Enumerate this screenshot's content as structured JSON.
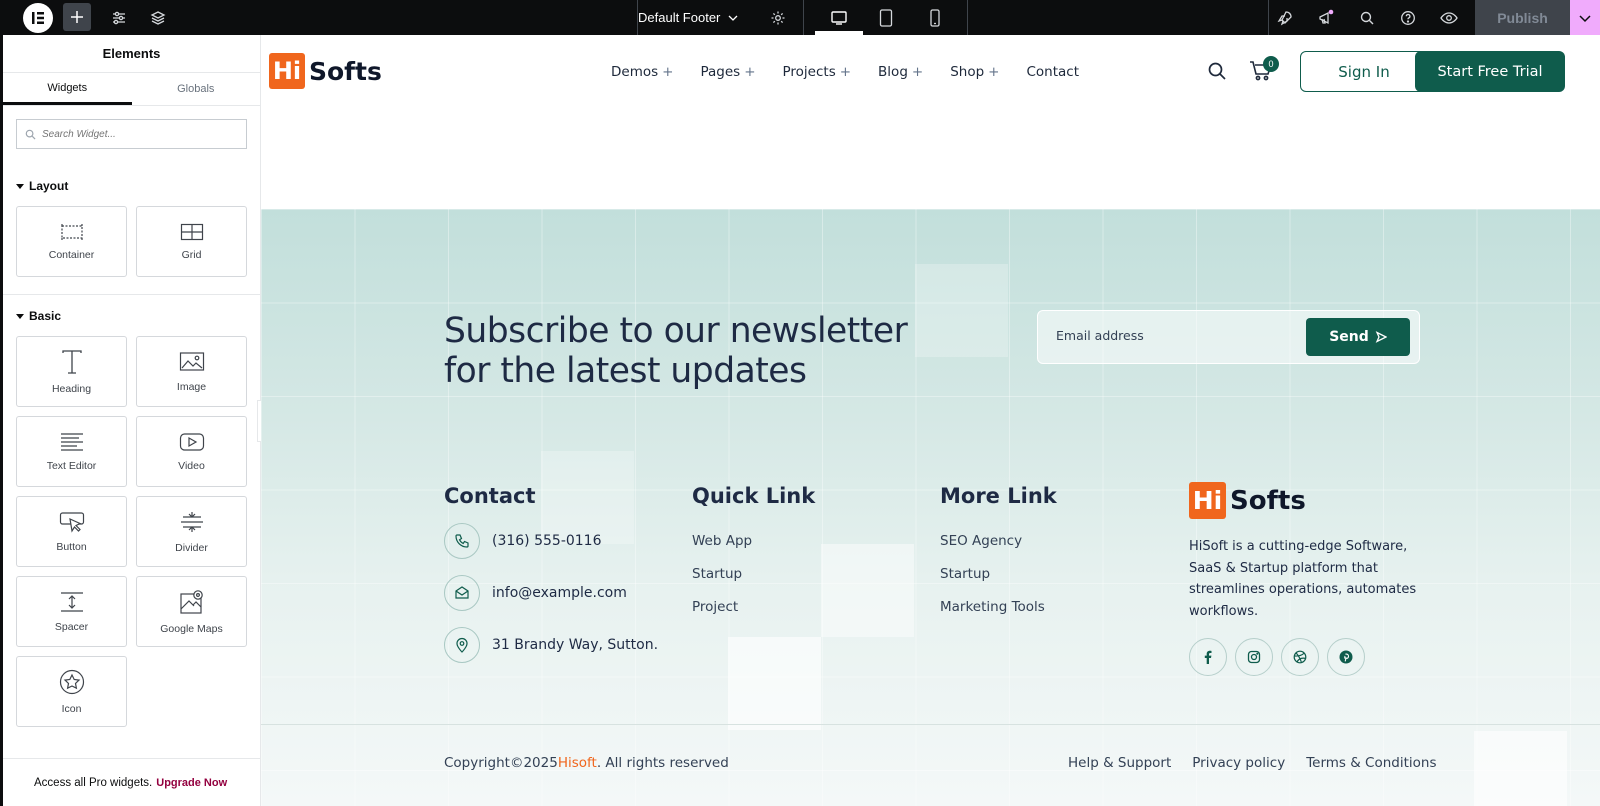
{
  "topbar": {
    "template_name": "Default Footer",
    "publish_label": "Publish",
    "colors": {
      "bar": "#0c0d0e",
      "accent": "#f0abfc"
    }
  },
  "panel": {
    "title": "Elements",
    "tabs": [
      "Widgets",
      "Globals"
    ],
    "search_placeholder": "Search Widget...",
    "categories": [
      {
        "name": "Layout",
        "widgets": [
          {
            "label": "Container",
            "icon": "container-icon"
          },
          {
            "label": "Grid",
            "icon": "grid-icon"
          }
        ]
      },
      {
        "name": "Basic",
        "widgets": [
          {
            "label": "Heading",
            "icon": "heading-icon"
          },
          {
            "label": "Image",
            "icon": "image-icon"
          },
          {
            "label": "Text Editor",
            "icon": "text-editor-icon"
          },
          {
            "label": "Video",
            "icon": "video-icon"
          },
          {
            "label": "Button",
            "icon": "button-icon"
          },
          {
            "label": "Divider",
            "icon": "divider-icon"
          },
          {
            "label": "Spacer",
            "icon": "spacer-icon"
          },
          {
            "label": "Google Maps",
            "icon": "google-maps-icon"
          },
          {
            "label": "Icon",
            "icon": "star-icon"
          }
        ]
      }
    ],
    "promo_text": "Access all Pro widgets.",
    "promo_link": "Upgrade Now"
  },
  "site": {
    "brand": {
      "hi": "Hi",
      "name": "Softs"
    },
    "nav": [
      {
        "label": "Demos",
        "plus": "+"
      },
      {
        "label": "Pages",
        "plus": "+"
      },
      {
        "label": "Projects",
        "plus": "+"
      },
      {
        "label": "Blog",
        "plus": "+"
      },
      {
        "label": "Shop",
        "plus": "+"
      },
      {
        "label": "Contact",
        "plus": ""
      }
    ],
    "cart_count": "0",
    "sign_in": "Sign In",
    "trial": "Start Free Trial",
    "brand_color": "#0f5c4c",
    "accent_color": "#f0661d"
  },
  "footer": {
    "newsletter_line1": "Subscribe to our newsletter",
    "newsletter_line2": "for the latest updates",
    "email_placeholder": "Email address",
    "send": "Send",
    "contact": {
      "title": "Contact",
      "phone": "(316) 555-0116",
      "email": "info@example.com",
      "address": "31 Brandy Way, Sutton."
    },
    "quick": {
      "title": "Quick Link",
      "links": [
        "Web App",
        "Startup",
        "Project"
      ]
    },
    "more": {
      "title": "More Link",
      "links": [
        "SEO Agency",
        "Startup",
        "Marketing Tools"
      ]
    },
    "about": "HiSoft is a cutting-edge Software, SaaS & Startup platform that streamlines operations, automates workflows.",
    "social": [
      "facebook-icon",
      "instagram-icon",
      "dribbble-icon",
      "pinterest-icon"
    ],
    "copyright_pre": "Copyright©2025",
    "copyright_brand": "Hisoft",
    "copyright_post": ". All rights reserved",
    "bottom_links": [
      "Help & Support",
      "Privacy policy",
      "Terms & Conditions"
    ]
  }
}
